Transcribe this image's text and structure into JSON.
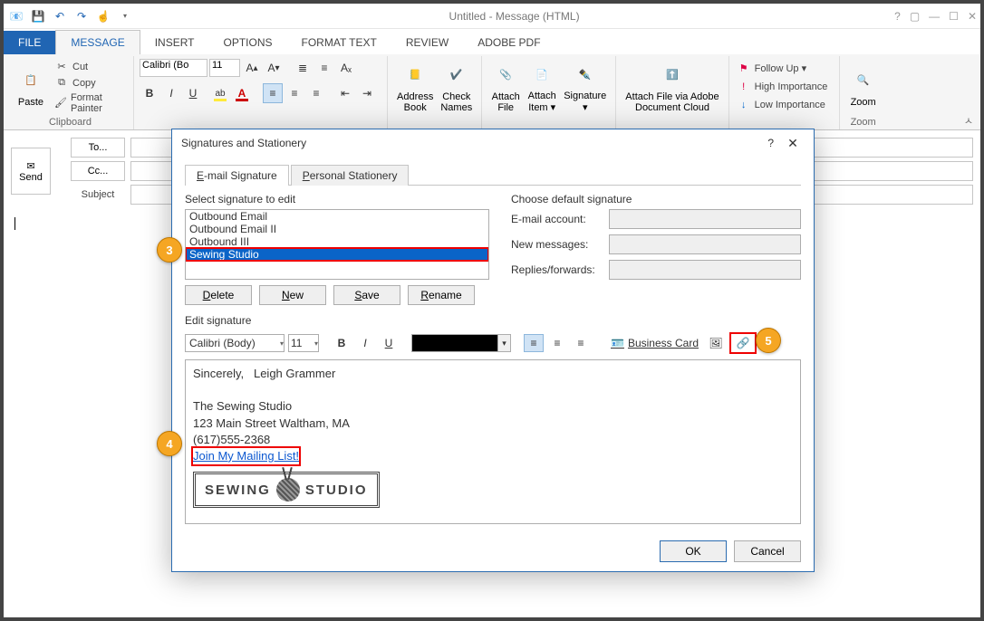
{
  "titlebar": {
    "title": "Untitled - Message (HTML)"
  },
  "qat": {
    "save": "💾",
    "undo": "↶",
    "redo": "↷"
  },
  "tabs": [
    "FILE",
    "MESSAGE",
    "INSERT",
    "OPTIONS",
    "FORMAT TEXT",
    "REVIEW",
    "ADOBE PDF"
  ],
  "ribbon": {
    "clipboard": {
      "paste": "Paste",
      "cut": "Cut",
      "copy": "Copy",
      "format_painter": "Format Painter",
      "label": "Clipboard"
    },
    "font": {
      "name": "Calibri (Bo",
      "size": "11"
    },
    "names": {
      "address_book": "Address\nBook",
      "check_names": "Check\nNames"
    },
    "include": {
      "attach_file": "Attach\nFile",
      "attach_item": "Attach\nItem ▾",
      "signature": "Signature\n▾"
    },
    "adobe": {
      "label": "Attach File via Adobe\nDocument Cloud"
    },
    "tags": {
      "follow_up": "Follow Up ▾",
      "high": "High Importance",
      "low": "Low Importance"
    },
    "zoom": {
      "label": "Zoom",
      "group": "Zoom"
    }
  },
  "compose": {
    "send": "Send",
    "to": "To...",
    "cc": "Cc...",
    "subject": "Subject"
  },
  "dialog": {
    "title": "Signatures and Stationery",
    "tabs": {
      "sig": "E-mail Signature",
      "stationery": "Personal Stationery"
    },
    "select_label": "Select signature to edit",
    "sig_list": [
      "Outbound Email",
      "Outbound Email II",
      "Outbound III",
      "Sewing Studio"
    ],
    "buttons": {
      "delete": "Delete",
      "new": "New",
      "save": "Save",
      "rename": "Rename"
    },
    "default_label": "Choose default signature",
    "defaults": {
      "account": "E-mail account:",
      "new_msg": "New messages:",
      "replies": "Replies/forwards:"
    },
    "edit_label": "Edit signature",
    "toolbar": {
      "font": "Calibri (Body)",
      "size": "11",
      "biz": "Business Card"
    },
    "content": {
      "line1a": "Sincerely,",
      "line1b": "Leigh Grammer",
      "company": "The Sewing Studio",
      "address": "123 Main Street Waltham, MA",
      "phone": "(617)555-2368",
      "link": "Join My Mailing List!",
      "logo_l": "SEWING",
      "logo_r": "STUDIO"
    },
    "footer": {
      "ok": "OK",
      "cancel": "Cancel"
    }
  },
  "callouts": {
    "c3": "3",
    "c4": "4",
    "c5": "5"
  }
}
